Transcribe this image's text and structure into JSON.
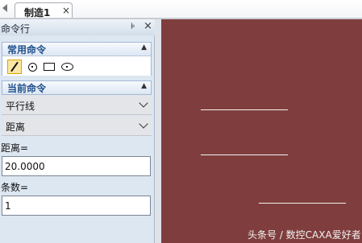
{
  "tabs": [
    {
      "label": "制造1",
      "close_symbol": "×"
    }
  ],
  "panel": {
    "title": "命令行",
    "pin_symbol": "⊧",
    "close_symbol": "×",
    "common_section": {
      "title": "常用命令",
      "collapse_symbol": "▲",
      "tools": [
        {
          "name": "line",
          "active": true
        },
        {
          "name": "circle",
          "active": false
        },
        {
          "name": "rectangle",
          "active": false
        },
        {
          "name": "ellipse",
          "active": false
        }
      ]
    },
    "current_section": {
      "title": "当前命令",
      "collapse_symbol": "▲",
      "mode_select": "平行线",
      "method_select": "距离",
      "distance_label": "距离=",
      "distance_value": "20.0000",
      "count_label": "条数=",
      "count_value": "1"
    }
  },
  "canvas": {
    "background_color": "#7f3e3d",
    "line_color": "#f2f2f2",
    "watermark": "头条号 / 数控CAXA爱好者"
  }
}
